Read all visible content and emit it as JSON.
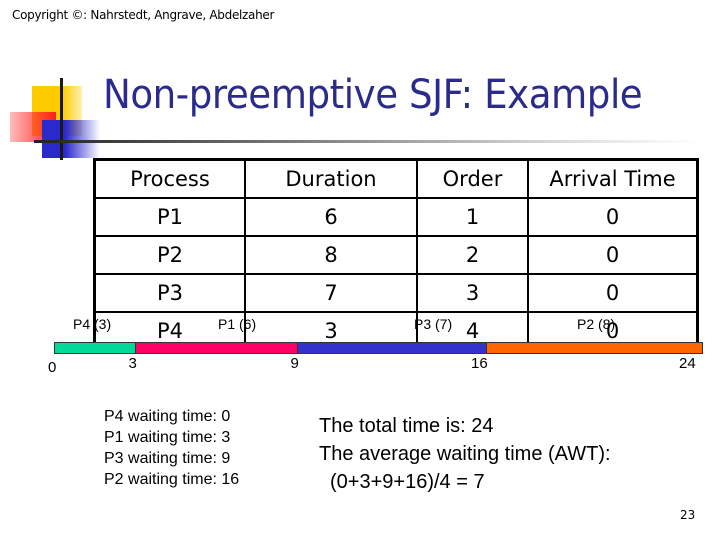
{
  "header": {
    "copyright": "Copyright ©: Nahrstedt, Angrave, Abdelzaher",
    "title": "Non-preemptive SJF: Example"
  },
  "table": {
    "columns": [
      "Process",
      "Duration",
      "Order",
      "Arrival Time"
    ],
    "rows": [
      [
        "P1",
        "6",
        "1",
        "0"
      ],
      [
        "P2",
        "8",
        "2",
        "0"
      ],
      [
        "P3",
        "7",
        "3",
        "0"
      ],
      [
        "P4",
        "3",
        "4",
        "0"
      ]
    ]
  },
  "gantt": {
    "segments": [
      {
        "label": "P4 (3)",
        "start": 0,
        "end": 3,
        "color": "#00d89a"
      },
      {
        "label": "P1 (6)",
        "start": 3,
        "end": 9,
        "color": "#ff0066"
      },
      {
        "label": "P3 (7)",
        "start": 9,
        "end": 16,
        "color": "#3333cc"
      },
      {
        "label": "P2 (8)",
        "start": 16,
        "end": 24,
        "color": "#ff6600"
      }
    ],
    "ticks": [
      "0",
      "3",
      "9",
      "16",
      "24"
    ]
  },
  "waiting_times": [
    "P4 waiting time: 0",
    "P1 waiting time: 3",
    "P3 waiting time: 9",
    "P2 waiting time: 16"
  ],
  "summary": [
    "The total time is: 24",
    "The average waiting time (AWT):",
    "(0+3+9+16)/4 = 7"
  ],
  "slide_number": "23"
}
